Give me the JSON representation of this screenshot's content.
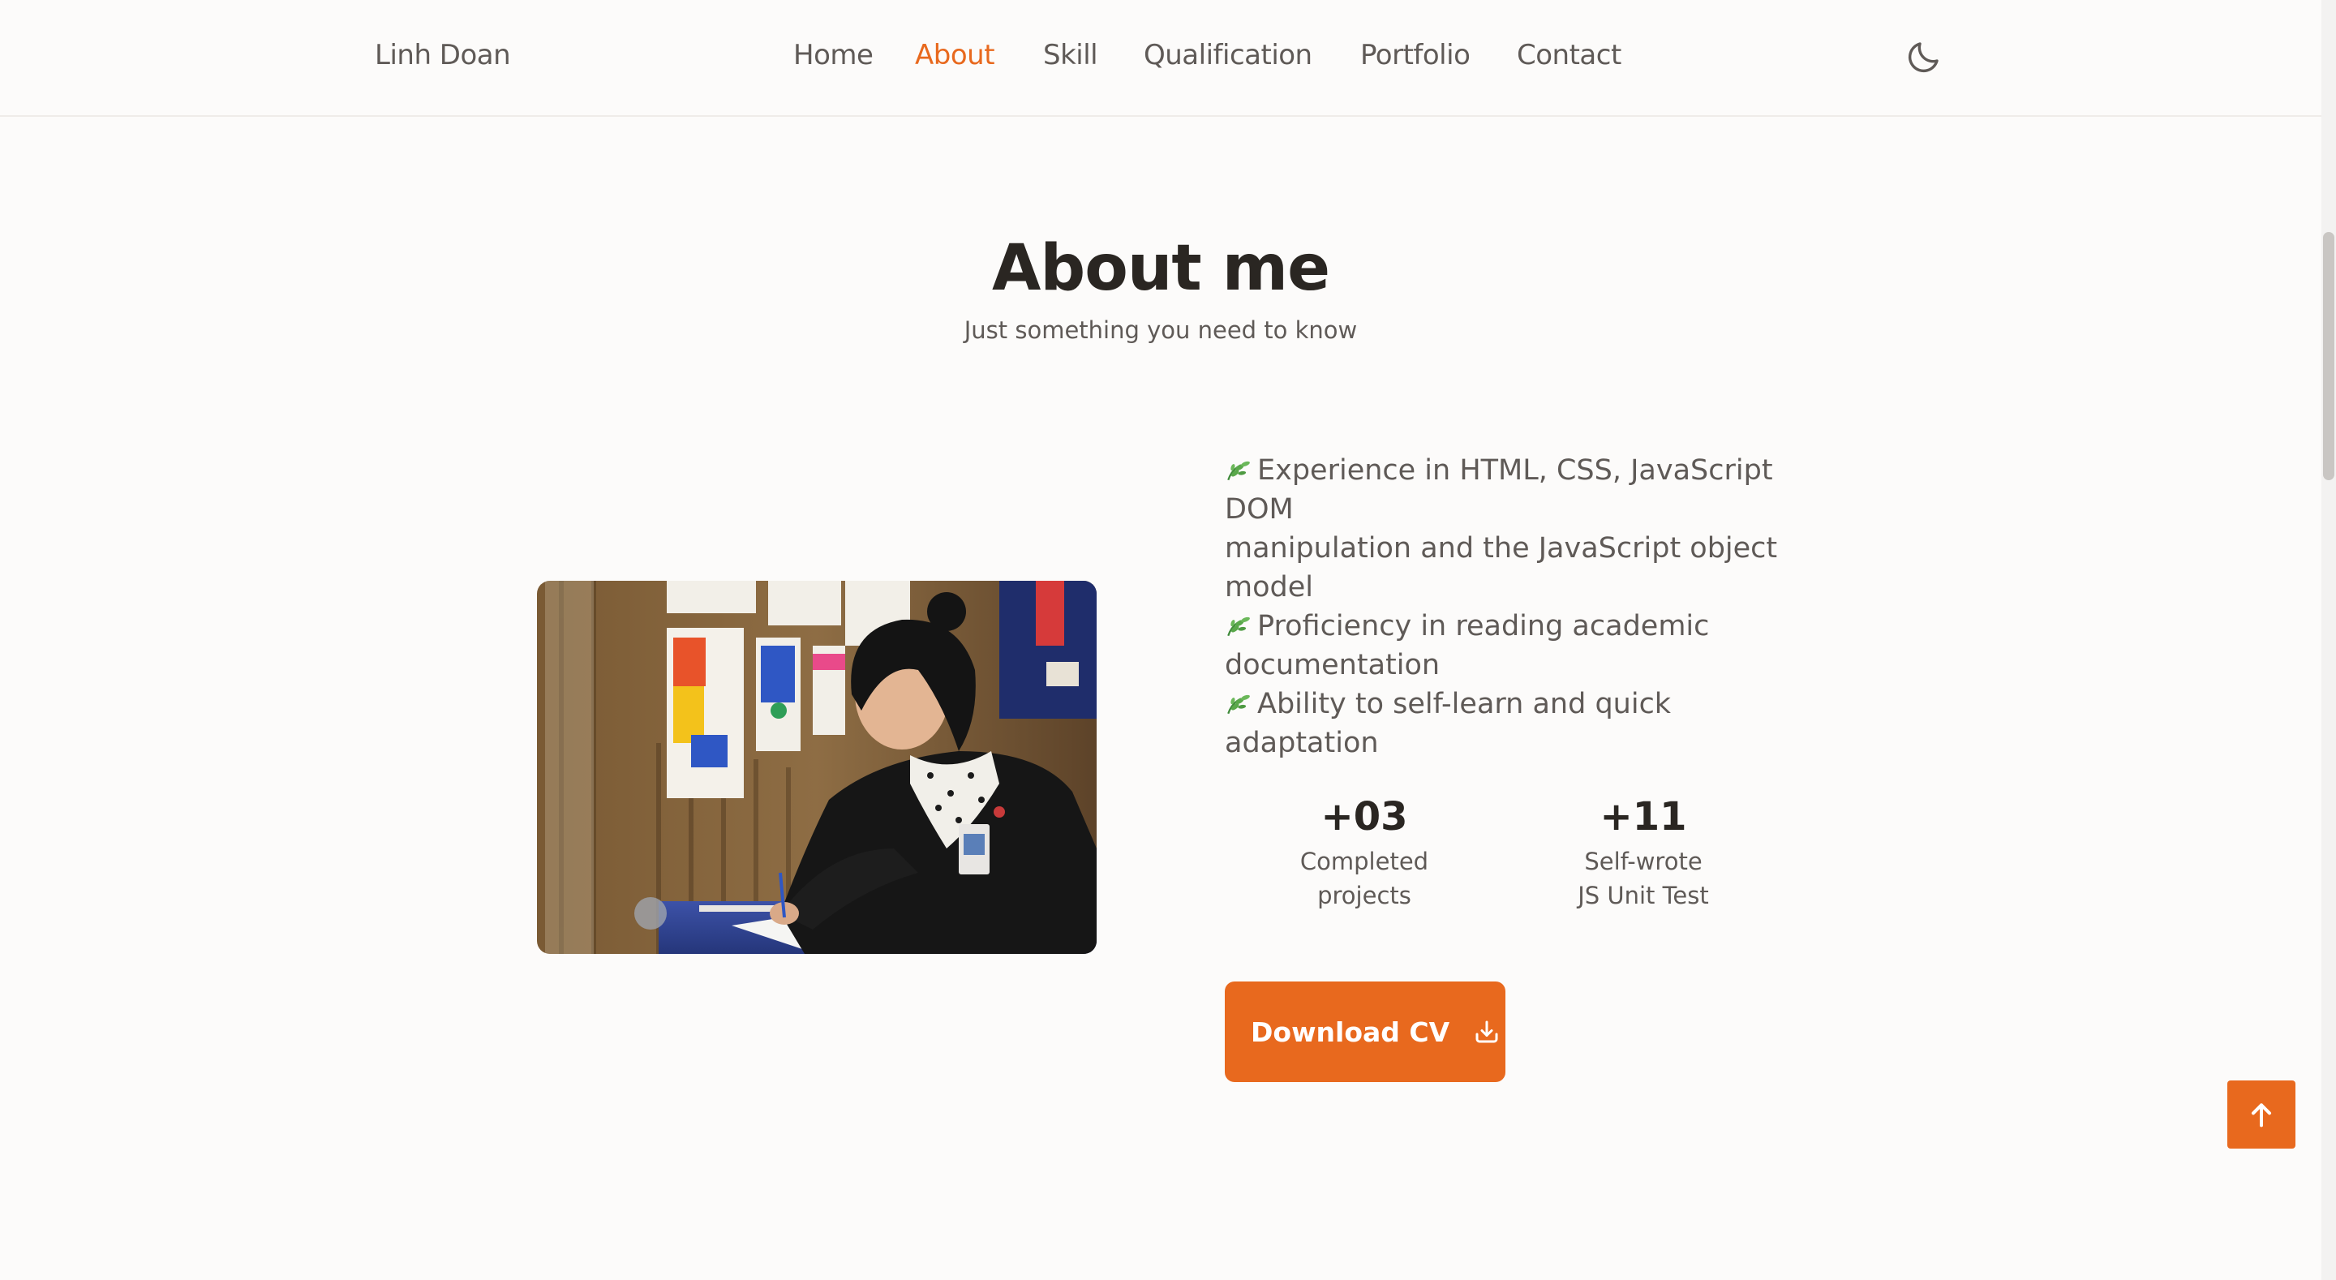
{
  "header": {
    "logo": "Linh Doan",
    "nav": [
      {
        "label": "Home"
      },
      {
        "label": "About",
        "active": true
      },
      {
        "label": "Skill"
      },
      {
        "label": "Qualification"
      },
      {
        "label": "Portfolio"
      },
      {
        "label": "Contact"
      }
    ],
    "theme_icon": "moon-icon"
  },
  "about": {
    "title": "About me",
    "subtitle": "Just something you need to know",
    "photo_icon": "profile-photo",
    "bullets": [
      [
        "Experience in HTML, CSS, JavaScript DOM",
        "manipulation and the JavaScript object",
        "model"
      ],
      [
        "Proficiency in reading academic",
        "documentation"
      ],
      [
        "Ability to self-learn and quick",
        "adaptation"
      ]
    ],
    "bullet_icon": "leaf-icon",
    "stats": [
      {
        "value": "+03",
        "label_lines": [
          "Completed",
          "projects"
        ]
      },
      {
        "value": "+11",
        "label_lines": [
          "Self-wrote",
          "JS Unit Test"
        ]
      }
    ],
    "download_label": "Download CV",
    "download_icon": "download-icon"
  },
  "scroll_up_icon": "arrow-up-icon",
  "colors": {
    "accent": "#e8691e",
    "background": "#fcfbfa",
    "text": "#5f5a57",
    "heading": "#2a2622"
  }
}
